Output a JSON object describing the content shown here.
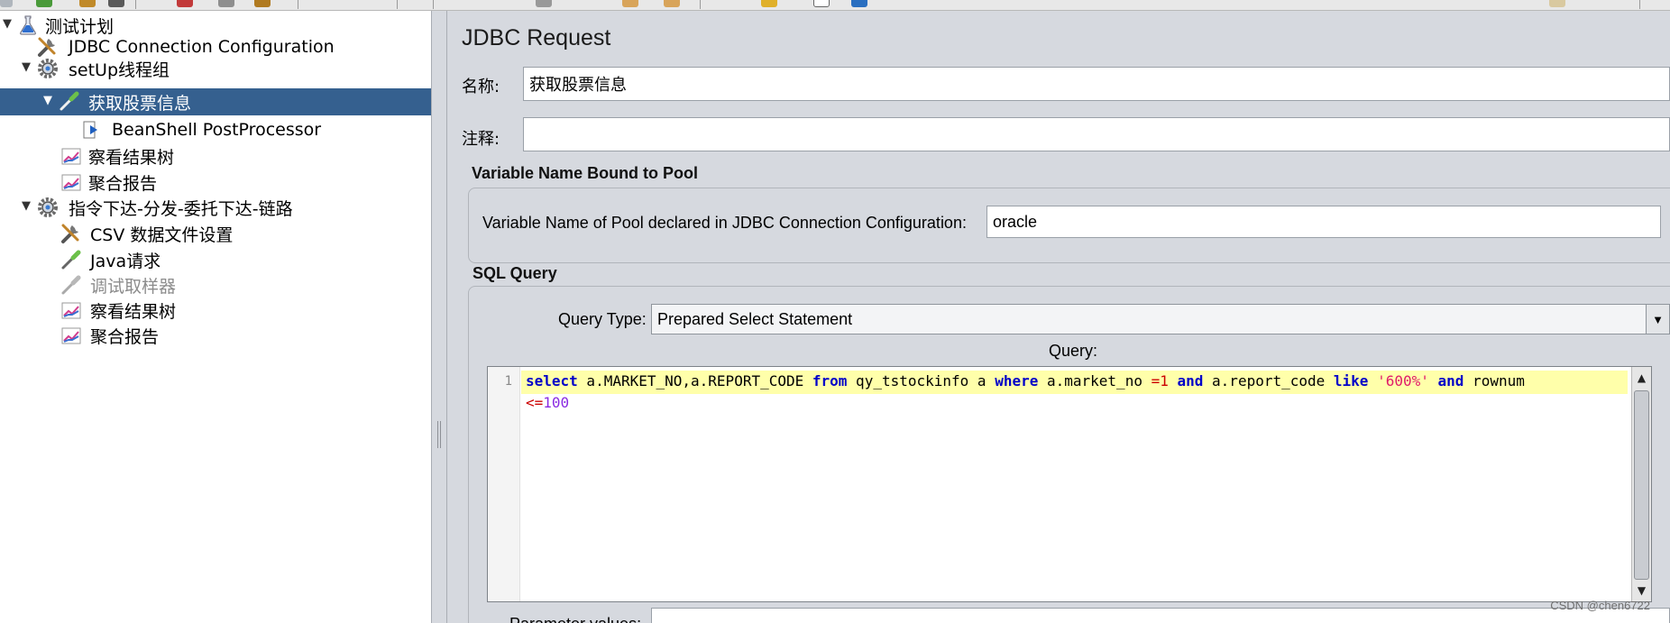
{
  "tree": {
    "items": [
      {
        "label": "测试计划",
        "icon": "flask-icon",
        "toggle": "▼"
      },
      {
        "label": "JDBC Connection Configuration",
        "icon": "wrench-icon",
        "toggle": ""
      },
      {
        "label": "setUp线程组",
        "icon": "gear-icon",
        "toggle": "▼"
      },
      {
        "label": "获取股票信息",
        "icon": "pipette-icon",
        "toggle": "▼",
        "selected": true
      },
      {
        "label": "BeanShell PostProcessor",
        "icon": "postprocessor-arrow-icon",
        "toggle": ""
      },
      {
        "label": "察看结果树",
        "icon": "graph-icon",
        "toggle": ""
      },
      {
        "label": "聚合报告",
        "icon": "graph-icon",
        "toggle": ""
      },
      {
        "label": "指令下达-分发-委托下达-链路",
        "icon": "gear-icon",
        "toggle": "▼"
      },
      {
        "label": "CSV 数据文件设置",
        "icon": "wrench-icon",
        "toggle": ""
      },
      {
        "label": "Java请求",
        "icon": "pipette-icon",
        "toggle": ""
      },
      {
        "label": "调试取样器",
        "icon": "pipette-icon",
        "toggle": "",
        "disabled": true
      },
      {
        "label": "察看结果树",
        "icon": "graph-icon",
        "toggle": ""
      },
      {
        "label": "聚合报告",
        "icon": "graph-icon",
        "toggle": ""
      }
    ]
  },
  "panel": {
    "title": "JDBC Request",
    "name_label": "名称:",
    "name_value": "获取股票信息",
    "comment_label": "注释:",
    "comment_value": "",
    "pool_group_title": "Variable Name Bound to Pool",
    "pool_label": "Variable Name of Pool declared in JDBC Connection Configuration:",
    "pool_value": "oracle",
    "sql_group_title": "SQL Query",
    "query_type_label": "Query Type:",
    "query_type_value": "Prepared Select Statement",
    "query_label": "Query:",
    "line_number": "1",
    "parameter_values_label": "Parameter values:",
    "parameter_values_value": ""
  },
  "query_code": {
    "line1": [
      {
        "t": "select",
        "c": "kw"
      },
      {
        "t": " a.MARKET_NO,a.REPORT_CODE ",
        "c": "plain"
      },
      {
        "t": "from",
        "c": "kw"
      },
      {
        "t": " qy_tstockinfo a ",
        "c": "plain"
      },
      {
        "t": "where",
        "c": "kw"
      },
      {
        "t": " a.market_no ",
        "c": "plain"
      },
      {
        "t": "=1",
        "c": "op"
      },
      {
        "t": " ",
        "c": "plain"
      },
      {
        "t": "and",
        "c": "kw"
      },
      {
        "t": " a.report_code ",
        "c": "plain"
      },
      {
        "t": "like",
        "c": "kw"
      },
      {
        "t": " ",
        "c": "plain"
      },
      {
        "t": "'600%'",
        "c": "str"
      },
      {
        "t": " ",
        "c": "plain"
      },
      {
        "t": "and",
        "c": "kw"
      },
      {
        "t": " rownum",
        "c": "plain"
      }
    ],
    "line2": [
      {
        "t": "<=",
        "c": "op"
      },
      {
        "t": "100",
        "c": "num"
      }
    ]
  },
  "watermark": "CSDN @chen6722",
  "colors": {
    "selection": "#35608f",
    "panel_bg": "#d6d9df",
    "current_line": "#ffffaa",
    "keyword": "#0000c8",
    "string": "#e01b6a"
  }
}
